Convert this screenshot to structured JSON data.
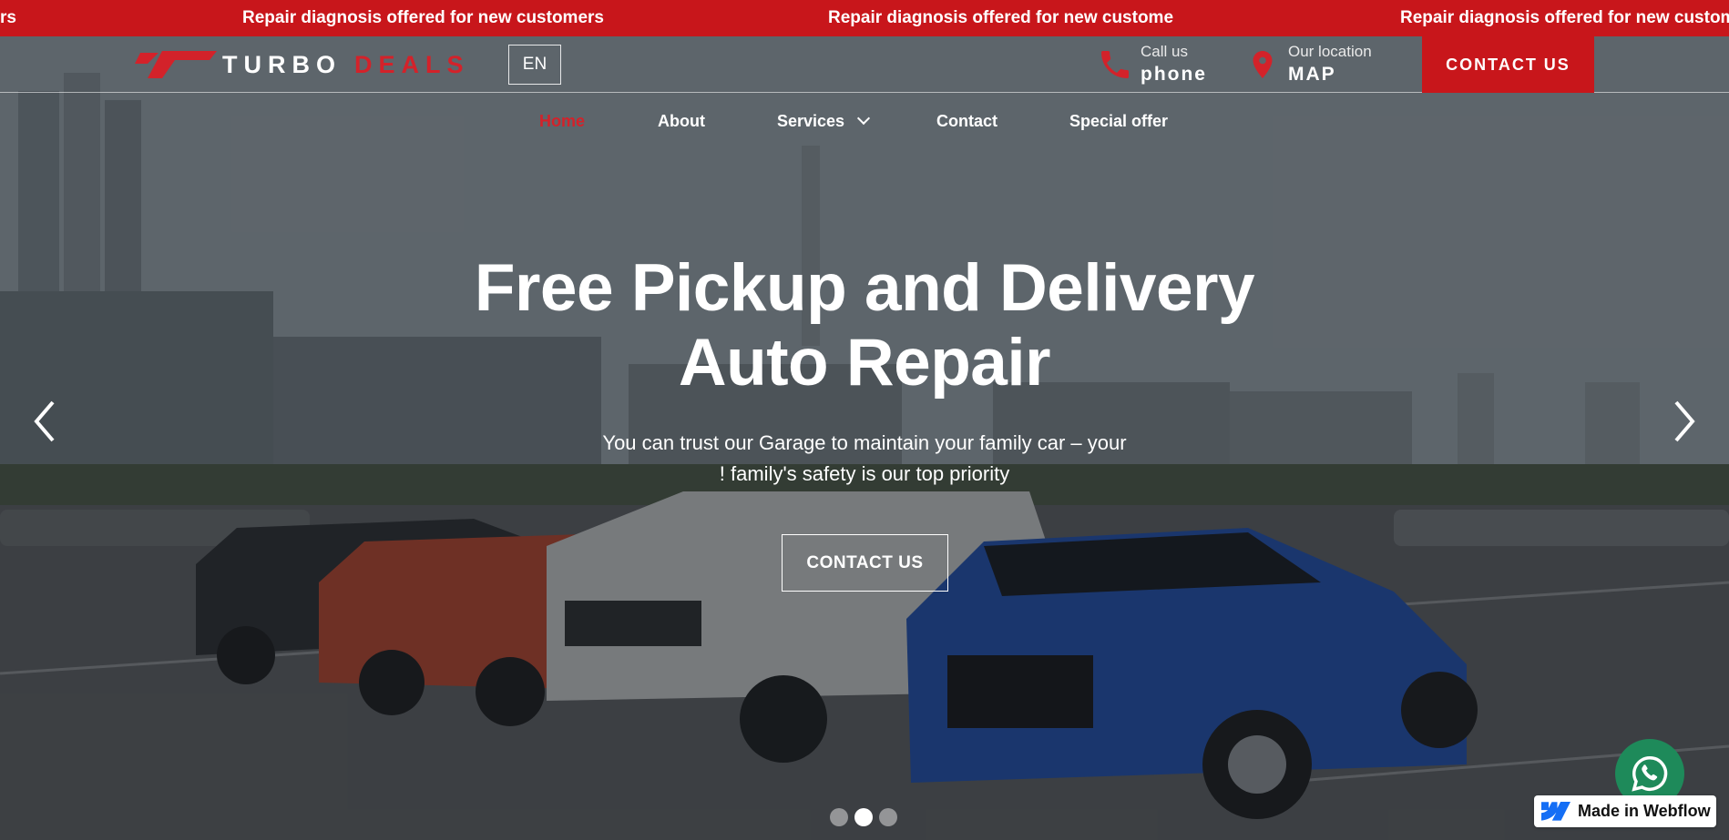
{
  "ticker": {
    "items": [
      "rs",
      "Repair diagnosis offered for new customers",
      "Repair diagnosis offered for new custome",
      "Repair diagnosis offered for new custom"
    ]
  },
  "header": {
    "logo_word1": "TURBO",
    "logo_word2": "DEALS",
    "language": "EN",
    "phone": {
      "label": "Call us",
      "value": "phone",
      "icon": "phone-icon"
    },
    "location": {
      "label": "Our location",
      "value": "MAP",
      "icon": "map-pin-icon"
    },
    "contact_button": "CONTACT US"
  },
  "nav": {
    "items": [
      {
        "label": "Home",
        "active": true
      },
      {
        "label": "About"
      },
      {
        "label": "Services",
        "dropdown": true
      },
      {
        "label": "Contact"
      },
      {
        "label": "Special offer"
      }
    ]
  },
  "hero": {
    "headline_line1": "Free Pickup and Delivery",
    "headline_line2": "Auto Repair",
    "subline_line1": "You can trust our Garage to maintain your family car – your",
    "subline_line2": "! family's safety is our top priority",
    "button": "CONTACT US"
  },
  "slider": {
    "slide_count": 3,
    "active_slide": 2
  },
  "badge": {
    "webflow": "Made in Webflow"
  },
  "colors": {
    "brand_red": "#c8161b",
    "accent_red": "#d3222a",
    "whatsapp_green": "#1e8a5a"
  }
}
